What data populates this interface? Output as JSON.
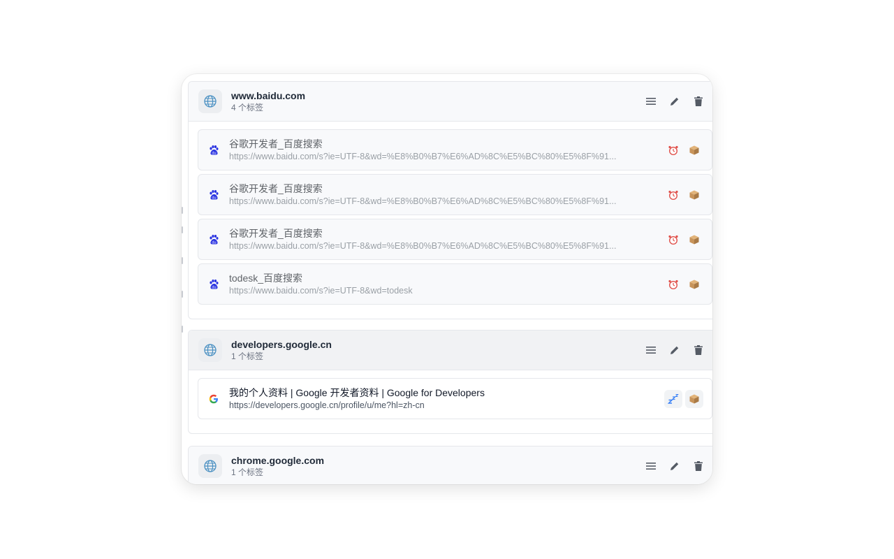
{
  "groups": [
    {
      "domain": "www.baidu.com",
      "count": "4 个标签",
      "tabs": [
        {
          "title": "谷歌开发者_百度搜索",
          "url": "https://www.baidu.com/s?ie=UTF-8&wd=%E8%B0%B7%E6%AD%8C%E5%BC%80%E5%8F%91..."
        },
        {
          "title": "谷歌开发者_百度搜索",
          "url": "https://www.baidu.com/s?ie=UTF-8&wd=%E8%B0%B7%E6%AD%8C%E5%BC%80%E5%8F%91..."
        },
        {
          "title": "谷歌开发者_百度搜索",
          "url": "https://www.baidu.com/s?ie=UTF-8&wd=%E8%B0%B7%E6%AD%8C%E5%BC%80%E5%8F%91..."
        },
        {
          "title": "todesk_百度搜索",
          "url": "https://www.baidu.com/s?ie=UTF-8&wd=todesk"
        }
      ]
    },
    {
      "domain": "developers.google.cn",
      "count": "1 个标签",
      "tabs": [
        {
          "title": "我的个人资料 | Google 开发者资料 | Google for Developers",
          "url": "https://developers.google.cn/profile/u/me?hl=zh-cn"
        }
      ]
    },
    {
      "domain": "chrome.google.com",
      "count": "1 个标签",
      "tabs": []
    }
  ],
  "icons": {
    "group": "globe-icon",
    "actions": [
      "menu-icon",
      "edit-icon",
      "trash-icon"
    ],
    "dim_tab_actions": [
      "alarm-clock-icon",
      "box-icon"
    ],
    "live_tab_actions": [
      "sleep-icon",
      "box-icon"
    ],
    "baidu_favicon": "baidu-paw-icon",
    "google_favicon": "google-g-icon"
  },
  "colors": {
    "globe": "#4a90c2",
    "baidu": "#2932e1",
    "alarm": "#e0504a",
    "box": "#c8945a",
    "sleep": "#3b82f6"
  }
}
